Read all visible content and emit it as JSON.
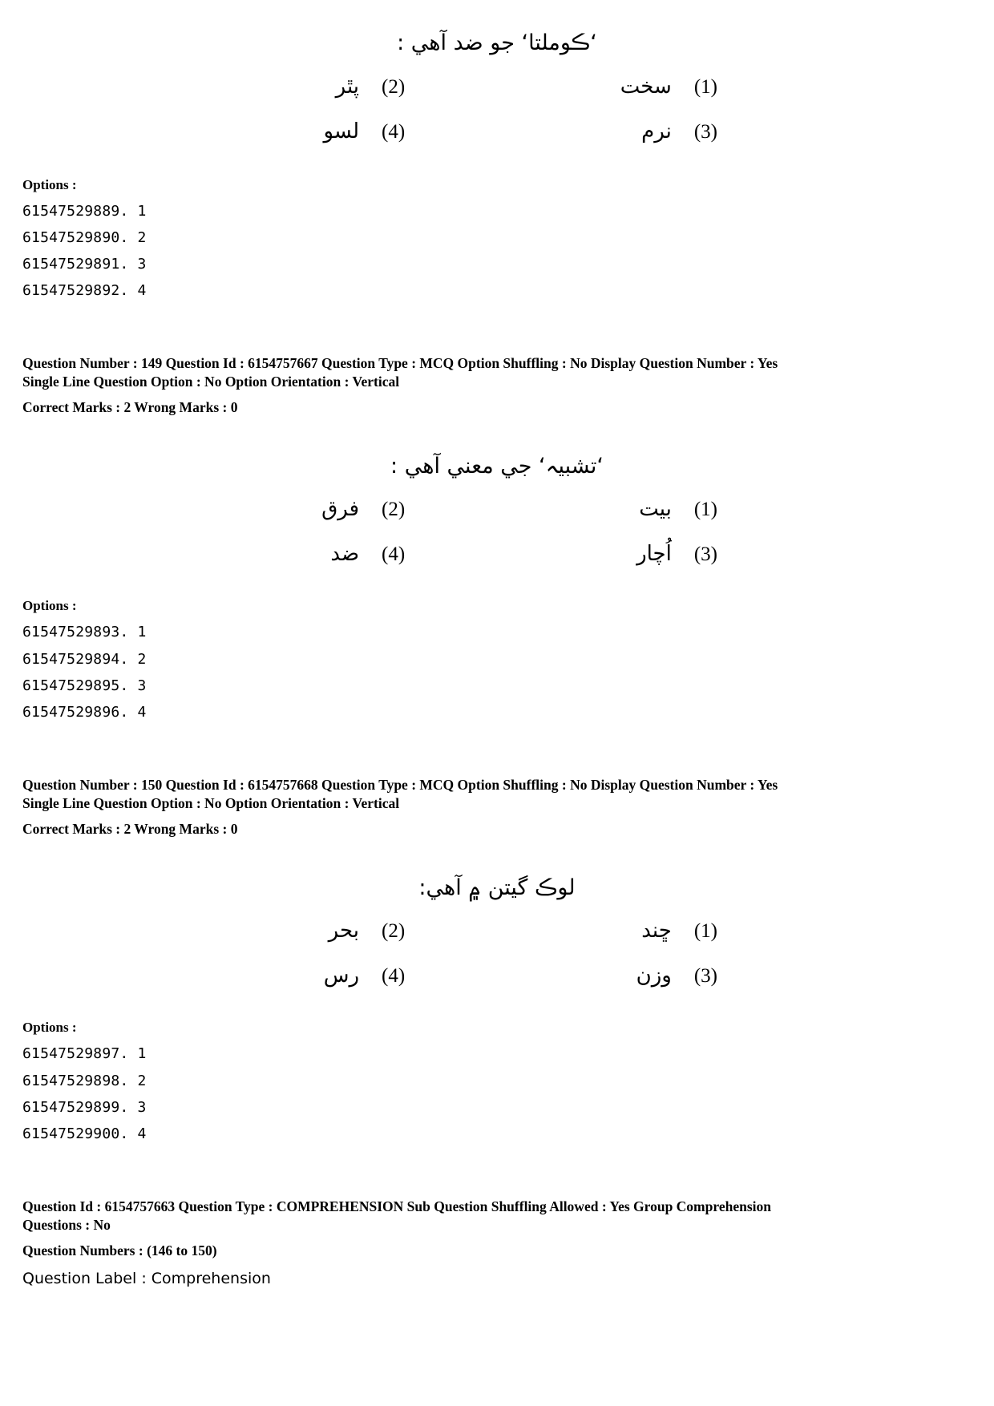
{
  "page": {
    "questions": [
      {
        "stem": "‘ڪوملتا‘ جو ضد آهي :",
        "options": [
          {
            "num": "(1)",
            "text": "سخت"
          },
          {
            "num": "(2)",
            "text": "پٿر"
          },
          {
            "num": "(3)",
            "text": "نرم"
          },
          {
            "num": "(4)",
            "text": "لسو"
          }
        ],
        "options_label": "Options :",
        "option_ids": [
          "61547529889. 1",
          "61547529890. 2",
          "61547529891. 3",
          "61547529892. 4"
        ],
        "meta": {
          "line1": "Question Number : 149  Question Id : 6154757667  Question Type : MCQ  Option Shuffling : No  Display Question Number : Yes",
          "line2": "Single Line Question Option : No  Option Orientation : Vertical",
          "line3": "Correct Marks : 2  Wrong Marks : 0"
        }
      },
      {
        "stem": "‘تشبيہ‘ جي معني آهي :",
        "options": [
          {
            "num": "(1)",
            "text": "بيت"
          },
          {
            "num": "(2)",
            "text": "فرق"
          },
          {
            "num": "(3)",
            "text": "اُچار"
          },
          {
            "num": "(4)",
            "text": "ضد"
          }
        ],
        "options_label": "Options :",
        "option_ids": [
          "61547529893. 1",
          "61547529894. 2",
          "61547529895. 3",
          "61547529896. 4"
        ],
        "meta": {
          "line1": "Question Number : 150  Question Id : 6154757668  Question Type : MCQ  Option Shuffling : No  Display Question Number : Yes",
          "line2": "Single Line Question Option : No  Option Orientation : Vertical",
          "line3": "Correct Marks : 2  Wrong Marks : 0"
        }
      },
      {
        "stem": "لوڪ گيتن ۾ آهي:",
        "options": [
          {
            "num": "(1)",
            "text": "ڇند"
          },
          {
            "num": "(2)",
            "text": "بحر"
          },
          {
            "num": "(3)",
            "text": "وزن"
          },
          {
            "num": "(4)",
            "text": "رس"
          }
        ],
        "options_label": "Options :",
        "option_ids": [
          "61547529897. 1",
          "61547529898. 2",
          "61547529899. 3",
          "61547529900. 4"
        ]
      }
    ],
    "comprehension": {
      "line1": "Question Id : 6154757663  Question Type : COMPREHENSION  Sub Question Shuffling Allowed : Yes  Group Comprehension",
      "line2": "Questions : No",
      "line3": "Question Numbers : (146 to 150)",
      "label": "Question Label : Comprehension"
    }
  }
}
